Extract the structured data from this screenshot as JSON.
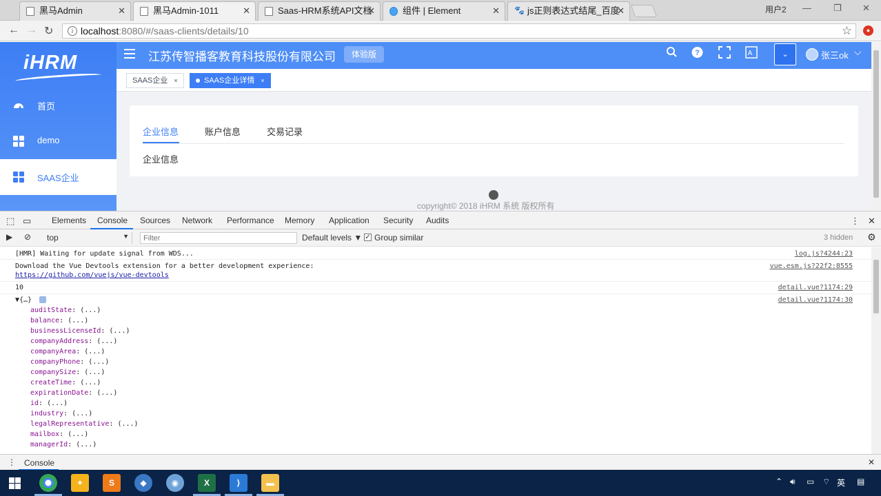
{
  "browser": {
    "tabs": [
      {
        "title": "黑马Admin",
        "icon": "page-icon"
      },
      {
        "title": "黑马Admin-1011",
        "icon": "page-icon",
        "active": true
      },
      {
        "title": "Saas-HRM系统API文档",
        "icon": "page-icon"
      },
      {
        "title": "组件 | Element",
        "icon": "element-icon"
      },
      {
        "title": "js正则表达式结尾_百度",
        "icon": "baidu-icon"
      }
    ],
    "user_label": "用户2",
    "url_host": "localhost",
    "url_rest": ":8080/#/saas-clients/details/10"
  },
  "app": {
    "logo": "iHRM",
    "company_name": "江苏传智播客教育科技股份有限公司",
    "trial_badge": "体验版",
    "username": "张三ok",
    "menu": [
      {
        "label": "首页",
        "icon": "dashboard-icon"
      },
      {
        "label": "demo",
        "icon": "grid-icon"
      },
      {
        "label": "SAAS企业",
        "icon": "grid-icon",
        "active": true
      }
    ],
    "tags": [
      {
        "label": "SAAS企业",
        "close": "×"
      },
      {
        "label": "SAAS企业详情",
        "close": "×",
        "active": true
      }
    ],
    "content_tabs": [
      "企业信息",
      "账户信息",
      "交易记录"
    ],
    "pane_text": "企业信息",
    "copyright": "copyright© 2018 iHRM 系统 版权所有"
  },
  "devtools": {
    "tabs": [
      "Elements",
      "Console",
      "Sources",
      "Network",
      "Performance",
      "Memory",
      "Application",
      "Security",
      "Audits"
    ],
    "active_tab": "Console",
    "context": "top",
    "filter_placeholder": "Filter",
    "levels": "Default levels ▼",
    "group_similar": "Group similar",
    "hidden": "3 hidden",
    "lines": [
      {
        "text": "[HMR] Waiting for update signal from WDS...",
        "source": "log.js?4244:23"
      },
      {
        "text": "Download the Vue Devtools extension for a better development experience:",
        "source": "vue.esm.js?22f2:8555"
      },
      {
        "text": "https://github.com/vuejs/vue-devtools",
        "source": ""
      },
      {
        "text": "10",
        "source": "detail.vue?1174:29"
      },
      {
        "text": "▼{…}",
        "source": "detail.vue?1174:30"
      }
    ],
    "object_props": [
      "auditState",
      "balance",
      "businessLicenseId",
      "companyAddress",
      "companyArea",
      "companyPhone",
      "companySize",
      "createTime",
      "expirationDate",
      "id",
      "industry",
      "legalRepresentative",
      "mailbox",
      "managerId"
    ],
    "prop_value": "(...)",
    "drawer_tab": "Console"
  },
  "taskbar": {
    "apps": [
      "chrome-icon",
      "browser-icon",
      "sublime-icon",
      "app-icon",
      "paint-icon",
      "excel-icon",
      "vscode-icon",
      "folder-icon"
    ],
    "ime": "英"
  },
  "colors": {
    "sidebar": "#3d7ef5",
    "topnav": "#4e8ef7",
    "accent": "#3d7ef5"
  }
}
